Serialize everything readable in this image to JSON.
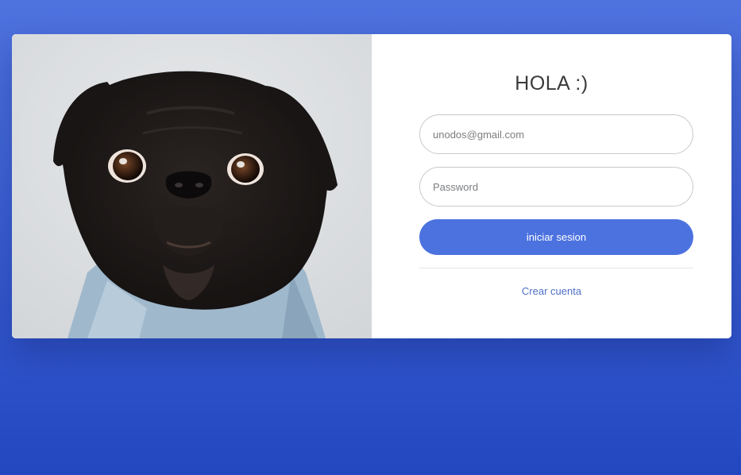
{
  "colors": {
    "background_top": "#4e72de",
    "background_bottom": "#2347bf",
    "card": "#ffffff",
    "accent": "#4c72e0",
    "link": "#4f6fc8"
  },
  "hero_image": {
    "subject": "black pug wearing a denim jacket"
  },
  "login": {
    "title": "HOLA :)",
    "email_placeholder": "unodos@gmail.com",
    "password_placeholder": "Password",
    "submit_label": "iniciar sesion",
    "create_account_label": "Crear cuenta"
  }
}
